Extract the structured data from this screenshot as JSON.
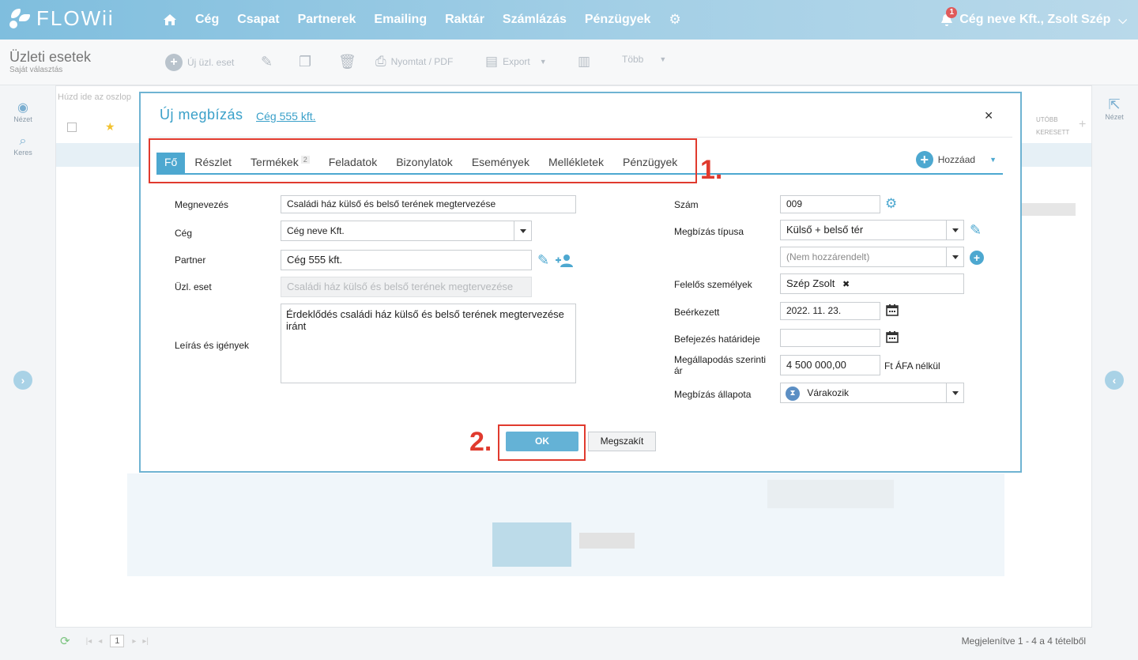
{
  "brand": {
    "name": "FLOWii"
  },
  "nav": {
    "items": [
      "Cég",
      "Csapat",
      "Partnerek",
      "Emailing",
      "Raktár",
      "Számlázás",
      "Pénzügyek"
    ]
  },
  "user": {
    "label": "Cég neve Kft., Zsolt Szép",
    "notifications": "1"
  },
  "page": {
    "title": "Üzleti esetek",
    "subtitle": "Saját választás"
  },
  "toolbar": {
    "new_label": "Új üzl. eset",
    "print_label": "Nyomtat / PDF",
    "export_label": "Export",
    "more_label": "Több"
  },
  "rail_left": {
    "view_label": "Nézet",
    "search_label": "Keres"
  },
  "rail_right": {
    "view_label": "Nézet"
  },
  "grid": {
    "group_placeholder": "Húzd ide az oszlop",
    "col_right_1": "UTÓBB",
    "col_right_2": "KERESETT"
  },
  "footer": {
    "page_number": "1",
    "status": "Megjelenítve 1 - 4 a 4 tételből"
  },
  "modal": {
    "title": "Új megbízás",
    "partner_link": "Cég 555 kft.",
    "add_label": "Hozzáad",
    "tabs": [
      {
        "label": "Fő"
      },
      {
        "label": "Részlet"
      },
      {
        "label": "Termékek",
        "count": "2"
      },
      {
        "label": "Feladatok"
      },
      {
        "label": "Bizonylatok"
      },
      {
        "label": "Események"
      },
      {
        "label": "Mellékletek"
      },
      {
        "label": "Pénzügyek"
      }
    ],
    "left": {
      "name_label": "Megnevezés",
      "name_value": "Családi ház külső és belső terének megtervezése",
      "company_label": "Cég",
      "company_value": "Cég neve Kft.",
      "partner_label": "Partner",
      "partner_value": "Cég 555 kft.",
      "case_label": "Üzl. eset",
      "case_value": "Családi ház külső és belső terének megtervezése",
      "desc_label": "Leírás és igények",
      "desc_value": "Érdeklődés családi ház külső és belső terének megtervezése iránt"
    },
    "right": {
      "number_label": "Szám",
      "number_value": "009",
      "type_label": "Megbízás típusa",
      "type_value": "Külső + belső tér",
      "subtype_value": "(Nem hozzárendelt)",
      "responsible_label": "Felelős személyek",
      "responsible_value": "Szép Zsolt",
      "received_label": "Beérkezett",
      "received_value": "2022. 11. 23.",
      "deadline_label": "Befejezés határideje",
      "deadline_value": "",
      "price_label": "Megállapodás szerinti ár",
      "price_value": "4 500 000,00",
      "price_unit": "Ft ÁFA nélkül",
      "status_label": "Megbízás állapota",
      "status_value": "Várakozik"
    },
    "ok_label": "OK",
    "cancel_label": "Megszakít",
    "annotation_1": "1.",
    "annotation_2": "2."
  },
  "colors": {
    "accent": "#4da8d0",
    "annotation": "#e03a2e",
    "topbar": "#7fbede"
  }
}
